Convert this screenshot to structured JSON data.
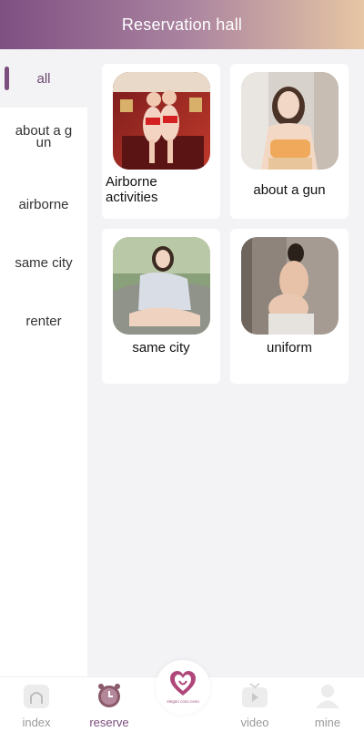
{
  "header": {
    "title": "Reservation hall"
  },
  "sidebar": {
    "items": [
      {
        "label": "all",
        "active": true
      },
      {
        "label": "about a gun"
      },
      {
        "label": "airborne"
      },
      {
        "label": "same city"
      },
      {
        "label": "renter"
      }
    ]
  },
  "cards": [
    {
      "label": "Airborne activities",
      "image": "group-photo-holiday-room"
    },
    {
      "label": "about a gun",
      "image": "portrait-orange-top"
    },
    {
      "label": "same city",
      "image": "portrait-car-seat"
    },
    {
      "label": "uniform",
      "image": "portrait-wall"
    }
  ],
  "tabbar": {
    "tabs": [
      {
        "label": "index",
        "icon": "home-icon"
      },
      {
        "label": "reserve",
        "icon": "clock-icon",
        "active": true
      },
      {
        "label": "video",
        "icon": "tv-icon"
      },
      {
        "label": "mine",
        "icon": "user-icon"
      }
    ],
    "center": {
      "icon": "heart-logo-icon",
      "caption": "elegan cono ceno"
    }
  },
  "colors": {
    "accent": "#7a4d7d",
    "header_start": "#7e4f82",
    "header_end": "#e6c6a4"
  }
}
